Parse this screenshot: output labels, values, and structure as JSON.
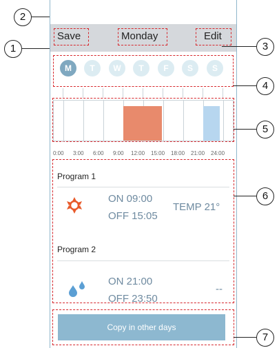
{
  "header": {
    "save_label": "Save",
    "day_label": "Monday",
    "edit_label": "Edit"
  },
  "days": [
    "M",
    "T",
    "W",
    "T",
    "F",
    "S",
    "S"
  ],
  "timeline": {
    "hours": [
      "0:00",
      "3:00",
      "6:00",
      "9:00",
      "12:00",
      "15:00",
      "18:00",
      "21:00",
      "24:00"
    ]
  },
  "programs": [
    {
      "title": "Program 1",
      "on": "ON 09:00",
      "off": "OFF 15:05",
      "temp": "TEMP 21°",
      "icon": "sun-icon"
    },
    {
      "title": "Program 2",
      "on": "ON 21:00",
      "off": "OFF 23:50",
      "temp": "--",
      "icon": "water-drops-icon"
    }
  ],
  "copy_button": {
    "label": "Copy in other days"
  },
  "callouts": [
    "1",
    "2",
    "3",
    "4",
    "5",
    "6",
    "7"
  ],
  "colors": {
    "accent": "#7fa8c0",
    "program_1": "#e88a6c",
    "program_2": "#b7d6ef",
    "annotation": "#d6262b"
  }
}
